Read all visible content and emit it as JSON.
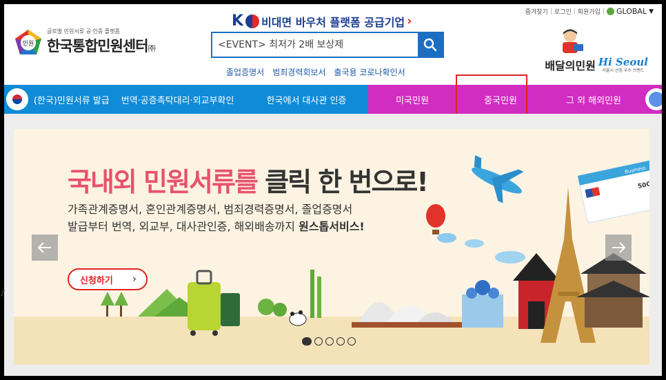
{
  "header": {
    "util_links": [
      "즐겨찾기",
      "로그인",
      "회원가입"
    ],
    "global_label": "GLOBAL",
    "logo_small": "글로벌 민원서류 공·인증 플랫폼",
    "logo_name": "한국통합민원센터",
    "logo_suffix": "㈜",
    "logo_badge": "민원",
    "ko_banner": "비대면 바우처 플랫폼 공급기업",
    "search_placeholder": "<EVENT> 최저가 2배 보상제",
    "quick_links": [
      "졸업증명서",
      "범죄경력회보서",
      "출국용 코로나확인서"
    ],
    "baedal_text": "배달의민원",
    "hiseoul_logo": "Hi Seoul",
    "hiseoul_sub": "서울시 선정 우수 브랜드"
  },
  "nav": {
    "items": [
      {
        "label": "(한국)민원서류 발급"
      },
      {
        "label": "번역·공증촉탁대리·외교부확인"
      },
      {
        "label": "한국에서 대사관 인증"
      },
      {
        "label": "미국민원"
      },
      {
        "label": "중국민원"
      },
      {
        "label": "그 외 해외민원"
      }
    ],
    "highlighted": "중국민원"
  },
  "banner": {
    "headline_part1": "국내외 민원서류를",
    "headline_part2": "클릭 한 번으로!",
    "sub_line1": "가족관계증명서, 혼인관계증명서, 범죄경력증명서, 졸업증명서",
    "sub_line2_plain": "발급부터 번역, 외교부, 대사관인증, 해외배송까지",
    "sub_line2_bold": "원스톱서비스!",
    "apply_label": "신청하기",
    "ticket_label": "Business",
    "ticket_seat": "50C",
    "slide_count": 5,
    "active_slide": 1
  },
  "colors": {
    "nav_blue": "#0f8bd7",
    "nav_magenta": "#d12dc1",
    "headline_pink": "#e8526b",
    "search_blue": "#1a6fc4",
    "highlight_red": "#e0231e"
  }
}
